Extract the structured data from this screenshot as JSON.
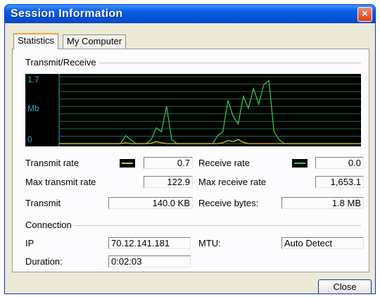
{
  "window": {
    "title": "Session Information",
    "close_glyph": "×"
  },
  "tabs": [
    {
      "label": "Statistics",
      "active": true
    },
    {
      "label": "My Computer",
      "active": false
    }
  ],
  "transmit_receive": {
    "group_label": "Transmit/Receive",
    "axis_max": "1.7",
    "axis_unit": "Mb",
    "axis_min": "0",
    "colors": {
      "background": "#000000",
      "grid": "#1f6b3a",
      "transmit": "#d7c22a",
      "receive": "#37c152",
      "axis": "#2ca8c0"
    },
    "transmit_series": [
      0,
      0,
      0,
      0,
      0,
      0,
      0,
      0,
      0,
      0,
      0,
      0,
      0,
      0.02,
      0,
      0,
      0,
      0,
      0.01,
      0.05,
      0.02,
      0,
      0,
      0,
      0,
      0,
      0,
      0,
      0,
      0,
      0,
      0,
      0.02,
      0.08,
      0.05,
      0.1,
      0.03,
      0,
      0,
      0,
      0,
      0,
      0,
      0,
      0,
      0,
      0,
      0,
      0,
      0,
      0,
      0,
      0,
      0,
      0,
      0,
      0,
      0,
      0,
      0
    ],
    "receive_series": [
      0,
      0,
      0,
      0,
      0,
      0,
      0,
      0,
      0,
      0,
      0,
      0,
      0,
      0.2,
      0.1,
      0,
      0,
      0,
      0.1,
      0.4,
      0.3,
      0.95,
      0.1,
      0,
      0,
      0,
      0,
      0,
      0,
      0,
      0,
      0.2,
      0.3,
      1.1,
      0.7,
      0.5,
      1.2,
      0.9,
      1.4,
      1.0,
      1.5,
      1.6,
      0.3,
      0.1,
      0,
      0,
      0,
      0,
      0,
      0,
      0,
      0,
      0,
      0,
      0,
      0,
      0,
      0,
      0,
      0
    ]
  },
  "stats": {
    "transmit_rate_label": "Transmit rate",
    "transmit_rate_value": "0.7",
    "receive_rate_label": "Receive rate",
    "receive_rate_value": "0.0",
    "max_transmit_rate_label": "Max transmit rate",
    "max_transmit_rate_value": "122.9",
    "max_receive_rate_label": "Max receive rate",
    "max_receive_rate_value": "1,653.1",
    "transmit_label": "Transmit",
    "transmit_value": "140.0 KB",
    "receive_bytes_label": "Receive bytes:",
    "receive_bytes_value": "1.8 MB"
  },
  "connection": {
    "group_label": "Connection",
    "ip_label": "IP",
    "ip_value": "70.12.141.181",
    "mtu_label": "MTU:",
    "mtu_value": "Auto Detect",
    "duration_label": "Duration:",
    "duration_value": "0:02:03"
  },
  "footer": {
    "close_label": "Close"
  }
}
